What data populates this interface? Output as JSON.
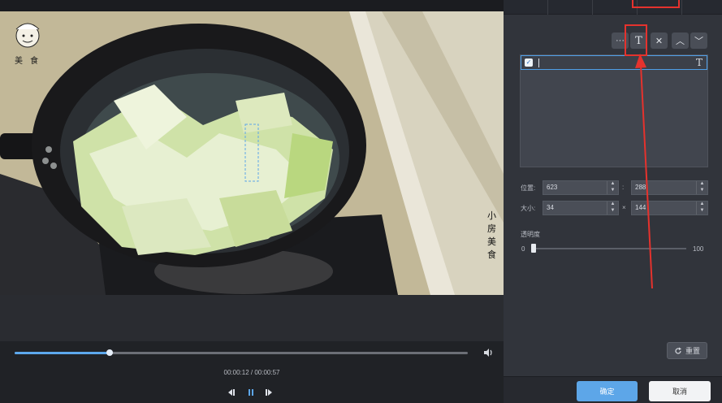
{
  "player": {
    "current_time": "00:00:12",
    "total_time": "00:00:57",
    "time_separator": " / ",
    "progress_fraction": 0.21
  },
  "video": {
    "watermark_top": "美 食",
    "watermark_right": "小房美食"
  },
  "panel": {
    "toolbar": {
      "more": "···",
      "text": "T",
      "delete": "✕",
      "up": "︿",
      "down": "﹀"
    },
    "layer": {
      "type_icon": "T",
      "checked": true
    },
    "position_label": "位置:",
    "position_x": "623",
    "position_y": "288",
    "size_label": "大小:",
    "size_w": "34",
    "size_h": "144",
    "size_sep": "×",
    "pos_sep": ":",
    "opacity_label": "透明度",
    "opacity_min": "0",
    "opacity_max": "100",
    "opacity_value": 0,
    "reset_label": "重置",
    "confirm_label": "确定",
    "cancel_label": "取消"
  },
  "colors": {
    "accent": "#5da6e8",
    "highlight": "#e5322d",
    "panel_bg": "#31343b"
  }
}
